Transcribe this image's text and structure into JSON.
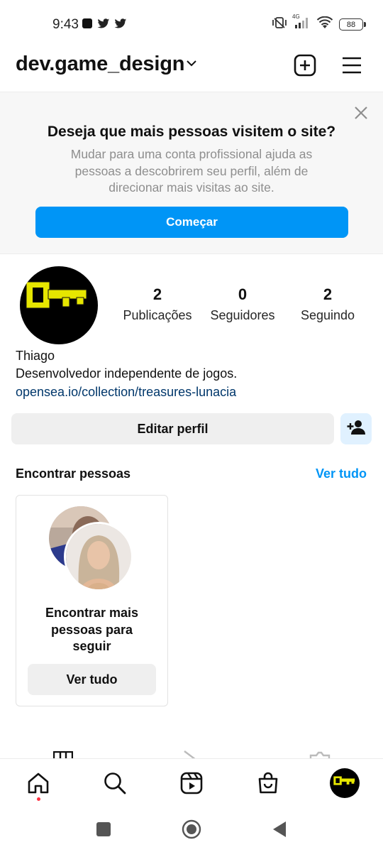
{
  "status_bar": {
    "time": "9:43",
    "network_type": "4G",
    "battery": "88"
  },
  "header": {
    "username": "dev.game_design"
  },
  "banner": {
    "title": "Deseja que mais pessoas visitem o site?",
    "text": "Mudar para uma conta profissional ajuda as pessoas a descobrirem seu perfil, além de direcionar mais visitas ao site.",
    "button_label": "Começar"
  },
  "profile": {
    "stats": [
      {
        "value": "2",
        "label": "Publicações"
      },
      {
        "value": "0",
        "label": "Seguidores"
      },
      {
        "value": "2",
        "label": "Seguindo"
      }
    ],
    "name": "Thiago",
    "bio": "Desenvolvedor independente de jogos.",
    "link": "opensea.io/collection/treasures-lunacia",
    "edit_button": "Editar perfil"
  },
  "find_people": {
    "title": "Encontrar pessoas",
    "see_all": "Ver tudo",
    "card_text": "Encontrar mais pessoas para seguir",
    "card_button": "Ver tudo"
  },
  "colors": {
    "accent": "#0095f6",
    "link": "#00376b",
    "notification": "#ff3040",
    "avatar_key": "#e6e600"
  },
  "icons": {
    "header": [
      "new-post-icon",
      "menu-icon"
    ],
    "bottom_nav": [
      "home-icon",
      "search-icon",
      "reels-icon",
      "shop-icon",
      "profile-avatar"
    ],
    "system_nav": [
      "recents-icon",
      "home-circle-icon",
      "back-icon"
    ]
  }
}
